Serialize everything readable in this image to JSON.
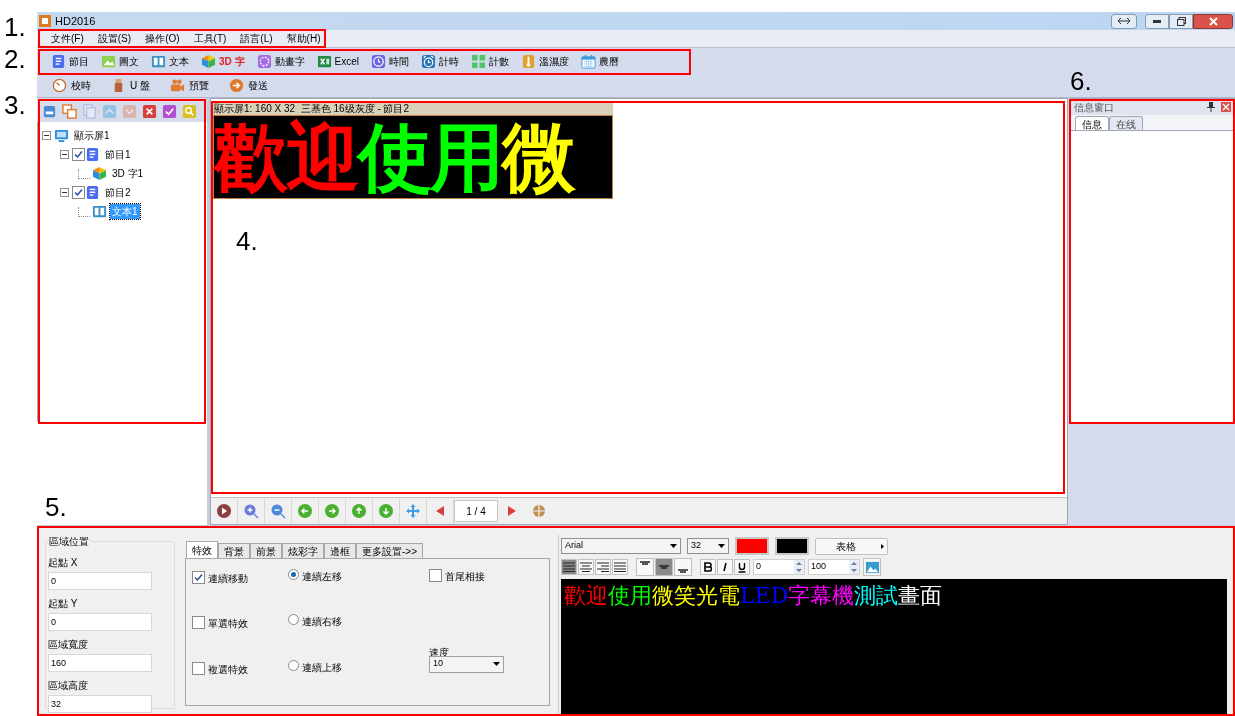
{
  "window": {
    "title": "HD2016"
  },
  "annotations": [
    {
      "number": "1.",
      "kind": "menu"
    },
    {
      "number": "2.",
      "kind": "toolbar"
    },
    {
      "number": "3.",
      "kind": "tree"
    },
    {
      "number": "4.",
      "kind": "preview"
    },
    {
      "number": "5.",
      "kind": "properties"
    },
    {
      "number": "6.",
      "kind": "info"
    }
  ],
  "menu": [
    "文件(F)",
    "設置(S)",
    "操作(O)",
    "工具(T)",
    "語言(L)",
    "幫助(H)"
  ],
  "toolbar": [
    {
      "label": "節目",
      "selected": false
    },
    {
      "label": "圖文",
      "selected": false
    },
    {
      "label": "文本",
      "selected": false
    },
    {
      "label": "3D 字",
      "selected": true
    },
    {
      "label": "動畫字",
      "selected": false
    },
    {
      "label": "Excel",
      "selected": false
    },
    {
      "label": "時間",
      "selected": false
    },
    {
      "label": "計時",
      "selected": false
    },
    {
      "label": "計數",
      "selected": false
    },
    {
      "label": "溫濕度",
      "selected": false
    },
    {
      "label": "農曆",
      "selected": false
    }
  ],
  "toolbar2": [
    "校時",
    "U 盤",
    "預覽",
    "發送"
  ],
  "tree_tools": [
    {
      "disabled": false
    },
    {
      "disabled": false
    },
    {
      "disabled": true
    },
    {
      "disabled": true
    },
    {
      "disabled": true
    },
    {
      "disabled": false
    },
    {
      "disabled": false
    },
    {
      "disabled": false
    }
  ],
  "tree": [
    {
      "label": "顯示屏1",
      "kind": "screen",
      "expanded": true,
      "selected": false,
      "children": [
        {
          "label": "節目1",
          "kind": "program",
          "checked": true,
          "expanded": true,
          "selected": false,
          "children": [
            {
              "label": "3D 字1",
              "kind": "cube",
              "selected": false
            }
          ]
        },
        {
          "label": "節目2",
          "kind": "program",
          "checked": true,
          "expanded": true,
          "selected": false,
          "children": [
            {
              "label": "文本1",
              "kind": "text",
              "selected": true
            }
          ]
        }
      ]
    }
  ],
  "preview": {
    "header": "顯示屏1: 160 X 32  三基色 16级灰度 - 節目2",
    "segments": [
      {
        "text": "歡迎",
        "color": "#ff0000"
      },
      {
        "text": "使用",
        "color": "#00ff00"
      },
      {
        "text": "微",
        "color": "#ffff00"
      }
    ]
  },
  "nav": {
    "page": "1 / 4"
  },
  "info_window": {
    "title": "信息窗口",
    "tabs": [
      {
        "label": "信息",
        "selected": true
      },
      {
        "label": "在线",
        "selected": false
      }
    ]
  },
  "region": {
    "title": "區域位置",
    "fields": [
      {
        "label": "起點 X",
        "value": "0"
      },
      {
        "label": "起點 Y",
        "value": "0"
      },
      {
        "label": "區域寬度",
        "value": "160"
      },
      {
        "label": "區域高度",
        "value": "32"
      }
    ]
  },
  "effects": {
    "tabs": [
      {
        "label": "特效",
        "selected": true
      },
      {
        "label": "背景",
        "selected": false
      },
      {
        "label": "前景",
        "selected": false
      },
      {
        "label": "炫彩字",
        "selected": false
      },
      {
        "label": "邊框",
        "selected": false
      },
      {
        "label": "更多設置->>",
        "selected": false
      }
    ],
    "checkboxes": [
      {
        "label": "連續移動",
        "checked": true
      },
      {
        "label": "單選特效",
        "checked": false
      },
      {
        "label": "複選特效",
        "checked": false
      }
    ],
    "radios": [
      {
        "label": "連續左移",
        "selected": true
      },
      {
        "label": "連續右移",
        "selected": false
      },
      {
        "label": "連續上移",
        "selected": false
      }
    ],
    "joint": {
      "label": "首尾相接",
      "checked": false
    },
    "speed_label": "速度",
    "speed": "10"
  },
  "editor": {
    "font": "Arial",
    "size": "32",
    "swatches": [
      {
        "color": "#ff0000"
      },
      {
        "color": "#000000"
      }
    ],
    "table_button": "表格",
    "h_align": [
      {
        "selected": true
      },
      {
        "selected": false
      },
      {
        "selected": false
      },
      {
        "selected": false
      }
    ],
    "v_align": [
      {
        "selected": false
      },
      {
        "selected": true
      },
      {
        "selected": false
      }
    ],
    "spin1": "0",
    "spin2": "100",
    "segments": [
      {
        "text": "歡迎",
        "color": "#ff0000"
      },
      {
        "text": "使用",
        "color": "#00ff00"
      },
      {
        "text": "微笑光電",
        "color": "#ffff00"
      },
      {
        "text": "LED",
        "color": "#0000ff"
      },
      {
        "text": "字幕機",
        "color": "#ff00ff"
      },
      {
        "text": "測試",
        "color": "#00ffff"
      },
      {
        "text": "畫面",
        "color": "#ffffff"
      }
    ]
  }
}
